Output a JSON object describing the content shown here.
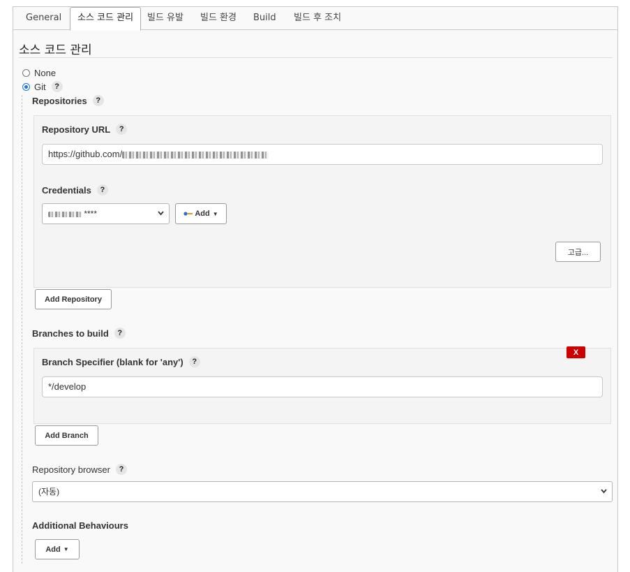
{
  "tabs": [
    "General",
    "소스 코드 관리",
    "빌드 유발",
    "빌드 환경",
    "Build",
    "빌드 후 조치"
  ],
  "active_tab": "소스 코드 관리",
  "section_title": "소스 코드 관리",
  "scm_options": {
    "none_label": "None",
    "git_label": "Git",
    "selected": "Git"
  },
  "help_glyph": "?",
  "repositories": {
    "heading": "Repositories",
    "url_label": "Repository URL",
    "url_value": "https://github.com/",
    "credentials_label": "Credentials",
    "credentials_value": "****",
    "add_credentials_label": "Add",
    "advanced_label": "고급...",
    "add_repository_label": "Add Repository"
  },
  "branches": {
    "heading": "Branches to build",
    "delete_label": "X",
    "specifier_label": "Branch Specifier (blank for 'any')",
    "specifier_value": "*/develop",
    "add_branch_label": "Add Branch"
  },
  "repository_browser": {
    "label": "Repository browser",
    "value": "(자동)"
  },
  "additional_behaviours": {
    "heading": "Additional Behaviours",
    "add_label": "Add"
  },
  "colors": {
    "accent": "#1a73e8",
    "danger": "#cc0000"
  },
  "icons": [
    "key-icon",
    "chevron-down-icon",
    "caret-down-icon"
  ]
}
